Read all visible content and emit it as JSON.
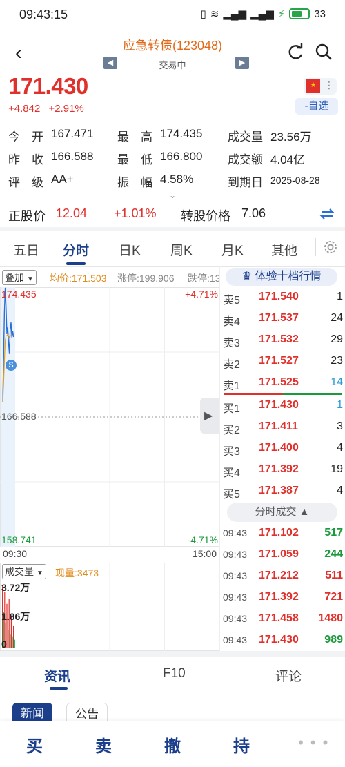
{
  "status": {
    "time": "09:43:15",
    "signal": "4G",
    "battery": "33"
  },
  "header": {
    "title": "应急转债(123048)",
    "subtitle": "交易中",
    "prev": "◀",
    "next": "▶"
  },
  "quote": {
    "price": "171.430",
    "change": "+4.842",
    "change_pct": "+2.91%",
    "watch_label": "-自选"
  },
  "stats": [
    [
      {
        "label": "今　开",
        "value": "167.471"
      },
      {
        "label": "最　高",
        "value": "174.435"
      },
      {
        "label": "成交量",
        "value": "23.56万"
      }
    ],
    [
      {
        "label": "昨　收",
        "value": "166.588"
      },
      {
        "label": "最　低",
        "value": "166.800"
      },
      {
        "label": "成交额",
        "value": "4.04亿"
      }
    ],
    [
      {
        "label": "评　级",
        "value": "AA+"
      },
      {
        "label": "振　幅",
        "value": "4.58%"
      },
      {
        "label": "到期日",
        "value": "2025-08-28"
      }
    ]
  ],
  "conversion": {
    "stock_price_label": "正股价",
    "stock_price": "12.04",
    "stock_change": "+1.01%",
    "conv_price_label": "转股价格",
    "conv_price": "7.06"
  },
  "tabs": [
    "五日",
    "分时",
    "日K",
    "周K",
    "月K",
    "其他"
  ],
  "active_tab": "分时",
  "chart_toolbar": {
    "overlay": "叠加",
    "avg": "均价:171.503",
    "limit_up": "涨停:199.906",
    "limit_down": "跌停:13"
  },
  "chart_data": {
    "type": "line",
    "y_max": "174.435",
    "y_mid": "166.588",
    "y_min": "158.741",
    "pct_max": "+4.71%",
    "pct_min": "-4.71%",
    "x_start": "09:30",
    "x_end": "15:00",
    "ylim": [
      158.741,
      174.435
    ],
    "reference": 166.588,
    "x": [
      0,
      1,
      2,
      3,
      4,
      5,
      6,
      7,
      8,
      9,
      10,
      11,
      12,
      13
    ],
    "price": [
      167.47,
      170.2,
      172.9,
      174.4,
      173.2,
      171.6,
      172.0,
      171.1,
      170.4,
      171.9,
      172.3,
      171.4,
      171.8,
      171.43
    ],
    "avg": [
      167.47,
      168.6,
      170.0,
      171.2,
      171.5,
      171.5,
      171.6,
      171.5,
      171.4,
      171.5,
      171.5,
      171.5,
      171.5,
      171.503
    ],
    "volume_label": "成交量",
    "current_volume": "现量:3473",
    "vol_max": "3.72万",
    "vol_mid": "1.86万",
    "vol_zero": "0",
    "volume": [
      3.72,
      2.1,
      3.3,
      1.5,
      2.6,
      1.1,
      2.9,
      0.8,
      1.9,
      0.7,
      1.3,
      0.5
    ],
    "volume_colors": [
      "red",
      "green",
      "red",
      "green",
      "red",
      "green",
      "red",
      "green",
      "red",
      "green",
      "red",
      "green"
    ]
  },
  "orderbook": {
    "trial_label": "体验十档行情",
    "asks": [
      {
        "label": "卖5",
        "price": "171.540",
        "qty": "1"
      },
      {
        "label": "卖4",
        "price": "171.537",
        "qty": "24"
      },
      {
        "label": "卖3",
        "price": "171.532",
        "qty": "29"
      },
      {
        "label": "卖2",
        "price": "171.527",
        "qty": "23"
      },
      {
        "label": "卖1",
        "price": "171.525",
        "qty": "14"
      }
    ],
    "bids": [
      {
        "label": "买1",
        "price": "171.430",
        "qty": "1"
      },
      {
        "label": "买2",
        "price": "171.411",
        "qty": "3"
      },
      {
        "label": "买3",
        "price": "171.400",
        "qty": "4"
      },
      {
        "label": "买4",
        "price": "171.392",
        "qty": "19"
      },
      {
        "label": "买5",
        "price": "171.387",
        "qty": "4"
      }
    ],
    "ticks_label": "分时成交 ▲",
    "ticks": [
      {
        "time": "09:43",
        "price": "171.102",
        "qty": "517",
        "color": "green"
      },
      {
        "time": "09:43",
        "price": "171.059",
        "qty": "244",
        "color": "green"
      },
      {
        "time": "09:43",
        "price": "171.212",
        "qty": "511",
        "color": "red"
      },
      {
        "time": "09:43",
        "price": "171.392",
        "qty": "721",
        "color": "red"
      },
      {
        "time": "09:43",
        "price": "171.458",
        "qty": "1480",
        "color": "red"
      },
      {
        "time": "09:43",
        "price": "171.430",
        "qty": "989",
        "color": "green"
      }
    ]
  },
  "bottom_tabs": [
    "资讯",
    "F10",
    "评论"
  ],
  "news_buttons": [
    "新闻",
    "公告"
  ],
  "actions": [
    "买",
    "卖",
    "撤",
    "持"
  ],
  "more": "• • •"
}
